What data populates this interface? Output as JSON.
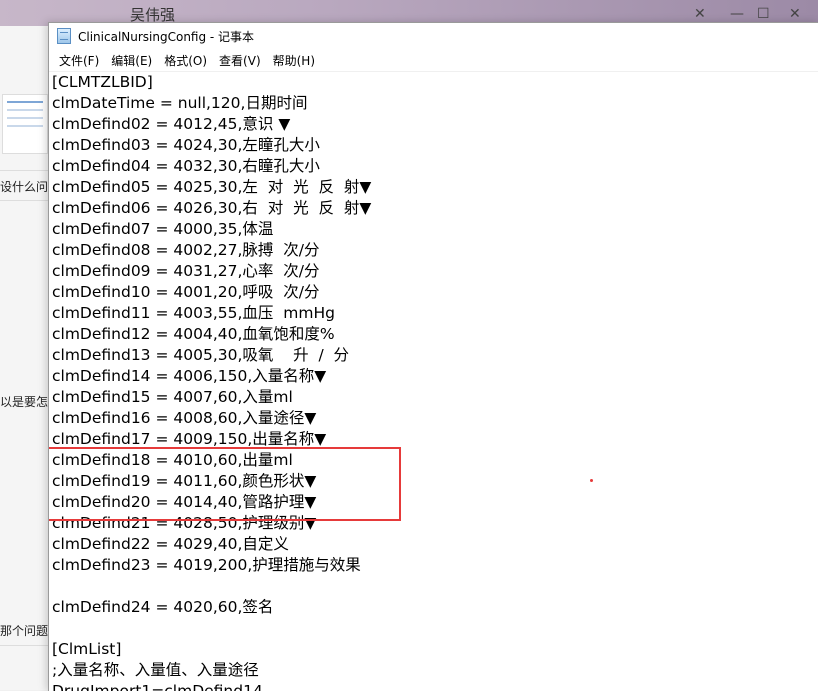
{
  "background": {
    "title": "吴伟强",
    "snippets": [
      "设什么问",
      "以是要怎",
      "那个问题"
    ]
  },
  "window": {
    "title": "ClinicalNursingConfig - 记事本",
    "menu": [
      "文件(F)",
      "编辑(E)",
      "格式(O)",
      "查看(V)",
      "帮助(H)"
    ]
  },
  "lines": [
    "[CLMTZLBID]",
    "clmDateTime = null,120,日期时间",
    "clmDefind02 = 4012,45,意识 ▼",
    "clmDefind03 = 4024,30,左瞳孔大小",
    "clmDefind04 = 4032,30,右瞳孔大小",
    "clmDefind05 = 4025,30,左  对  光  反  射▼",
    "clmDefind06 = 4026,30,右  对  光  反  射▼",
    "clmDefind07 = 4000,35,体温",
    "clmDefind08 = 4002,27,脉搏  次/分",
    "clmDefind09 = 4031,27,心率  次/分",
    "clmDefind10 = 4001,20,呼吸  次/分",
    "clmDefind11 = 4003,55,血压  mmHg",
    "clmDefind12 = 4004,40,血氧饱和度%",
    "clmDefind13 = 4005,30,吸氧    升  /  分",
    "clmDefind14 = 4006,150,入量名称▼",
    "clmDefind15 = 4007,60,入量ml",
    "clmDefind16 = 4008,60,入量途径▼",
    "clmDefind17 = 4009,150,出量名称▼",
    "clmDefind18 = 4010,60,出量ml",
    "clmDefind19 = 4011,60,颜色形状▼",
    "clmDefind20 = 4014,40,管路护理▼",
    "clmDefind21 = 4028,50,护理级别▼",
    "clmDefind22 = 4029,40,自定义",
    "clmDefind23 = 4019,200,护理措施与效果",
    "",
    "clmDefind24 = 4020,60,签名",
    "",
    "[ClmList]",
    ";入量名称、入量值、入量途径",
    "DrugImport1=clmDefind14"
  ],
  "colors": {
    "highlight": "#e63a3a"
  }
}
